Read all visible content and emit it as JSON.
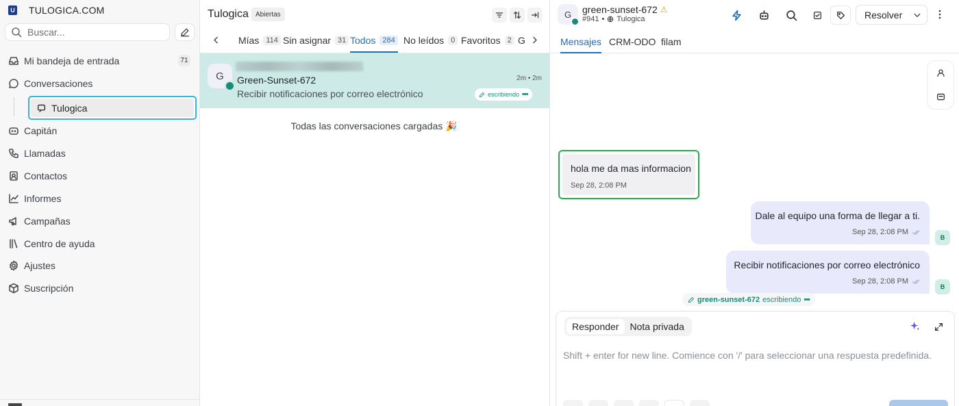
{
  "sidebar": {
    "brand": {
      "name": "TULOGICA.COM",
      "logo_letter": "U"
    },
    "search": {
      "placeholder": "Buscar..."
    },
    "inbox": {
      "label": "Mi bandeja de entrada",
      "badge": "71"
    },
    "conversations": {
      "label": "Conversaciones",
      "sub_item": "Tulogica"
    },
    "items": [
      {
        "label": "Capitán",
        "icon": "captain-icon"
      },
      {
        "label": "Llamadas",
        "icon": "phone-icon"
      },
      {
        "label": "Contactos",
        "icon": "contacts-icon"
      },
      {
        "label": "Informes",
        "icon": "chart-icon"
      },
      {
        "label": "Campañas",
        "icon": "megaphone-icon"
      },
      {
        "label": "Centro de ayuda",
        "icon": "library-icon"
      },
      {
        "label": "Ajustes",
        "icon": "gear-icon"
      },
      {
        "label": "Suscripción",
        "icon": "package-icon"
      }
    ]
  },
  "list": {
    "title": "Tulogica",
    "status": "Abiertas",
    "tabs": [
      {
        "label": "Mías",
        "count": "114"
      },
      {
        "label": "Sin asignar",
        "count": "31"
      },
      {
        "label": "Todos",
        "count": "284"
      },
      {
        "label": "No leídos",
        "count": "0"
      },
      {
        "label": "Favoritos",
        "count": "2"
      },
      {
        "label": "G",
        "count": ""
      }
    ],
    "conversation": {
      "avatar": "G",
      "name": "Green-Sunset-672",
      "time": "2m • 2m",
      "preview": "Recibir notificaciones por correo electrónico",
      "typing": "escribiendo"
    },
    "loaded_message": "Todas las conversaciones cargadas 🎉"
  },
  "chat": {
    "avatar": "G",
    "contact_name": "green-sunset-672",
    "warning_icon": "⚠",
    "conversation_id": "#941",
    "inbox_name": "Tulogica",
    "resolve_label": "Resolver",
    "tabs": [
      "Mensajes",
      "CRM-ODO",
      "filam"
    ],
    "messages": [
      {
        "direction": "incoming",
        "text": "hola me da mas informacion",
        "time": "Sep 28, 2:08 PM"
      },
      {
        "direction": "outgoing",
        "text": "Dale al equipo una forma de llegar a ti.",
        "time": "Sep 28, 2:08 PM",
        "avatar": "B"
      },
      {
        "direction": "outgoing",
        "text": "Recibir notificaciones por correo electrónico",
        "time": "Sep 28, 2:08 PM",
        "avatar": "B"
      }
    ],
    "typing_indicator": {
      "name": "green-sunset-672",
      "label": "escribiendo"
    },
    "composer": {
      "reply_label": "Responder",
      "private_note_label": "Nota privada",
      "placeholder": "Shift + enter for new line. Comience con '/' para seleccionar una respuesta predefinida."
    }
  },
  "colors": {
    "accent": "#1d6fb8",
    "selected_conversation_bg": "#cdeae7",
    "online_dot": "#1a8a7a",
    "outgoing_bubble": "#e8e9fa",
    "highlight_cyan": "#34b6d9",
    "highlight_green": "#21b24a"
  }
}
